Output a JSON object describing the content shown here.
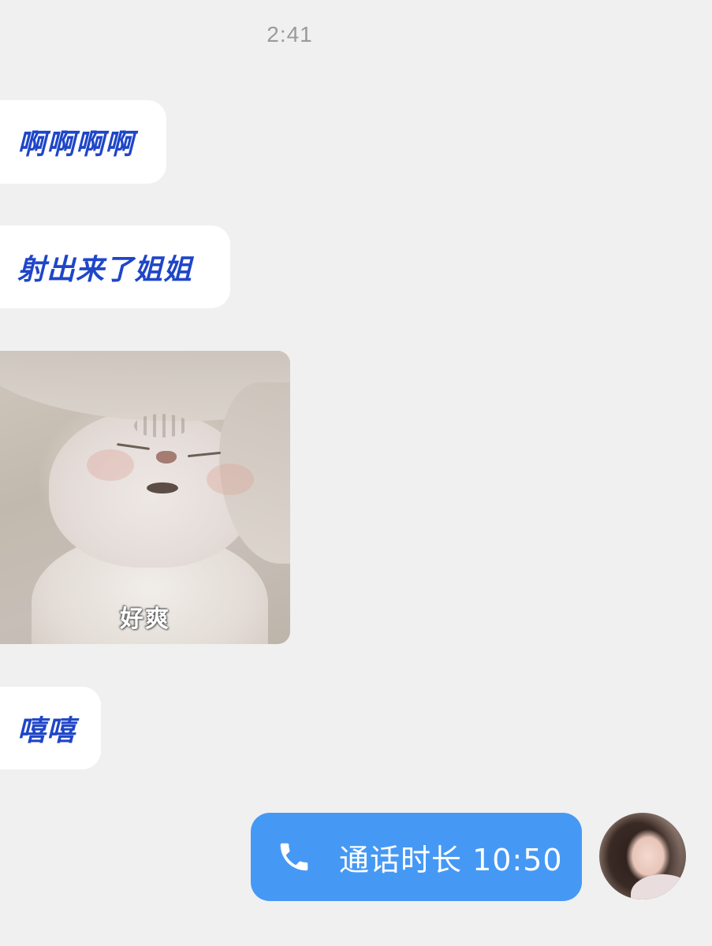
{
  "status": {
    "time": "2:41"
  },
  "messages": [
    {
      "type": "text",
      "side": "incoming",
      "text": "啊啊啊啊"
    },
    {
      "type": "text",
      "side": "incoming",
      "text": "射出来了姐姐"
    },
    {
      "type": "sticker",
      "side": "incoming",
      "caption": "好爽"
    },
    {
      "type": "text",
      "side": "incoming",
      "text": "嘻嘻"
    },
    {
      "type": "call",
      "side": "outgoing",
      "icon": "phone-icon",
      "text": "通话时长 10:50"
    }
  ],
  "colors": {
    "background": "#f0f0f0",
    "incoming_bubble": "#ffffff",
    "incoming_text": "#1f46c8",
    "outgoing_bubble": "#4599f5",
    "outgoing_text": "#ffffff",
    "timestamp": "#9a9a9a"
  }
}
